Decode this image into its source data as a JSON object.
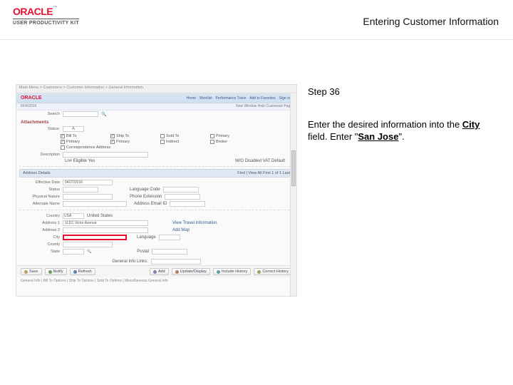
{
  "header": {
    "brand": "ORACLE",
    "kit": "USER PRODUCTIVITY KIT",
    "title": "Entering Customer Information"
  },
  "instruction": {
    "step": "Step 36",
    "line1": "Enter the desired information into the ",
    "field_name": "City",
    "line2": " field. Enter \"",
    "value": "San Jose",
    "line3": "\"."
  },
  "shot": {
    "breadcrumb": "Main Menu > Customers > Customer Information > General Information",
    "brand": "ORACLE",
    "toplinks": [
      "Home",
      "Worklist",
      "Performance Trace",
      "Add to Favorites",
      "Sign out"
    ],
    "subbar_left": "New Window   Help   Customize Page",
    "search_label": "Search",
    "date": "6/04/2016",
    "section_title": "Attachments",
    "row_status_label": "Status:",
    "row_status_value": "A",
    "checks": [
      {
        "label": "Bill To",
        "checked": true
      },
      {
        "label": "Ship To",
        "checked": true
      },
      {
        "label": "Sold To",
        "checked": false
      },
      {
        "label": "Primary",
        "checked": false
      },
      {
        "label": "Primary",
        "checked": true
      },
      {
        "label": "Primary",
        "checked": true
      },
      {
        "label": "Indirect",
        "checked": false
      },
      {
        "label": "Broker",
        "checked": false
      },
      {
        "label": "Correspondence Address",
        "checked": false
      }
    ],
    "rows1": [
      {
        "label": "Description",
        "value": "",
        "w": "w120"
      },
      {
        "label": "",
        "value2": "Ln# Eligible Yes",
        "checkextra": "W/O Disabled   VAT Default"
      }
    ],
    "sectionbar": {
      "left": "Address Details",
      "right": "Find | View All   First   1 of 1   Last"
    },
    "addr": [
      {
        "label": "Effective Date",
        "value": "04/27/2016",
        "w": "w70"
      },
      {
        "label": "Status",
        "value": "",
        "w": "w50",
        "extra": "Language Code"
      },
      {
        "label": "Physical Nature",
        "value": "",
        "w": "w70",
        "extra": "Phone Extension"
      },
      {
        "label": "Alternate Name",
        "value": "",
        "w": "w90",
        "extra": "Address Email ID"
      }
    ],
    "addr2": [
      {
        "label": "Country",
        "value": "USA   United States",
        "w": "w120"
      },
      {
        "label": "Address 1",
        "value": "11111 Victor Avenue",
        "w": "w120",
        "right": "View Travel Information"
      },
      {
        "label": "Address 2",
        "value": "",
        "w": "w120",
        "right": "Add Map"
      },
      {
        "label": "City",
        "value": "",
        "w": "w90",
        "highlight": true,
        "after": "Language"
      },
      {
        "label": "County",
        "value": "",
        "w": "w70"
      },
      {
        "label": "State",
        "value": "",
        "w": "w30",
        "after": "Postal"
      }
    ],
    "gen_link": "General Info Links:",
    "buttons_left": [
      "Save",
      "Notify",
      "Refresh"
    ],
    "buttons_right": [
      "Add",
      "Update/Display",
      "Include History",
      "Correct History"
    ],
    "footer": "General Info | Bill To Options | Ship To Options | Sold To Options | Miscellaneous General Info"
  }
}
